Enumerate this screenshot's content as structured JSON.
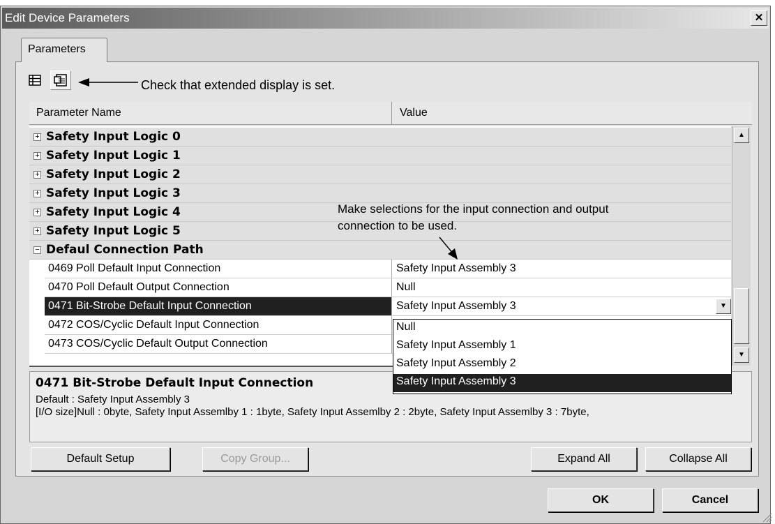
{
  "window": {
    "title": "Edit Device Parameters",
    "close_glyph": "✕"
  },
  "tabs": [
    {
      "label": "Parameters"
    }
  ],
  "toolbar": {
    "list_view_icon": "list-view-icon",
    "extended_view_icon": "extended-view-icon"
  },
  "annotations": {
    "extended_display_note": "Check that extended display is set.",
    "selection_note_line1": "Make selections for the input connection and output",
    "selection_note_line2": "connection to be used."
  },
  "grid": {
    "headers": {
      "name": "Parameter Name",
      "value": "Value"
    },
    "groups": [
      {
        "label": "Safety Input Logic 0",
        "expanded": false
      },
      {
        "label": "Safety Input Logic 1",
        "expanded": false
      },
      {
        "label": "Safety Input Logic 2",
        "expanded": false
      },
      {
        "label": "Safety Input Logic 3",
        "expanded": false
      },
      {
        "label": "Safety Input Logic 4",
        "expanded": false
      },
      {
        "label": "Safety Input Logic 5",
        "expanded": false
      },
      {
        "label": "Defaul Connection Path",
        "expanded": true
      }
    ],
    "rows": [
      {
        "name": "0469 Poll Default Input Connection",
        "value": "Safety Input Assembly 3"
      },
      {
        "name": "0470 Poll Default Output Connection",
        "value": "Null"
      },
      {
        "name": "0471 Bit-Strobe Default Input Connection",
        "value": "Safety Input Assembly 3",
        "selected": true
      },
      {
        "name": "0472 COS/Cyclic Default Input Connection",
        "value": ""
      },
      {
        "name": "0473 COS/Cyclic Default Output Connection",
        "value": ""
      }
    ],
    "dropdown_options": [
      "Null",
      "Safety Input Assembly 1",
      "Safety Input Assembly 2",
      "Safety Input Assembly 3"
    ],
    "dropdown_highlighted": "Safety Input Assembly 3"
  },
  "description": {
    "title": "0471 Bit-Strobe Default Input Connection",
    "default_line": "Default : Safety Input Assembly 3",
    "size_line": "[I/O size]Null : 0byte, Safety Input Assemlby 1 : 1byte, Safety Input Assemlby 2 : 2byte, Safety Input Assemlby 3 : 7byte,"
  },
  "buttons": {
    "default_setup": "Default Setup",
    "copy_group": "Copy Group...",
    "expand_all": "Expand All",
    "collapse_all": "Collapse All",
    "ok": "OK",
    "cancel": "Cancel"
  }
}
